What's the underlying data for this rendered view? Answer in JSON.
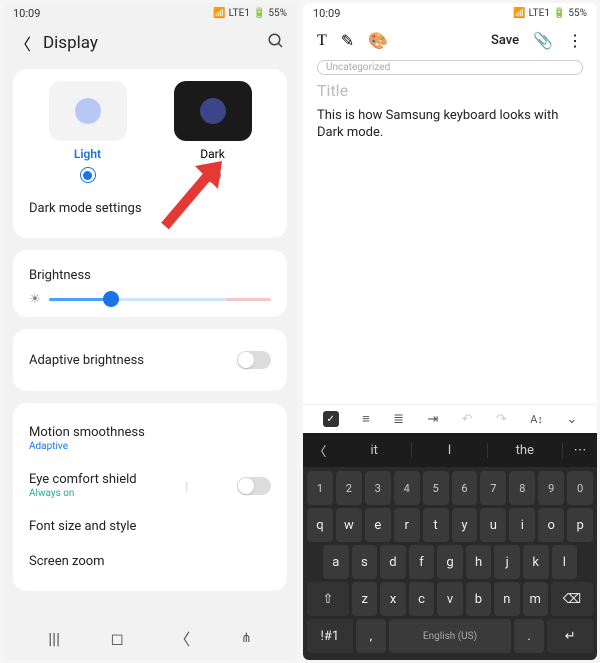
{
  "status": {
    "time": "10:09",
    "battery": "55%",
    "net": "LTE1"
  },
  "left": {
    "title": "Display",
    "theme": {
      "light": "Light",
      "dark": "Dark",
      "selected": "light"
    },
    "darkModeSettings": "Dark mode settings",
    "brightness": {
      "label": "Brightness",
      "value": 28
    },
    "adaptive": "Adaptive brightness",
    "motion": {
      "label": "Motion smoothness",
      "sub": "Adaptive"
    },
    "eye": {
      "label": "Eye comfort shield",
      "sub": "Always on"
    },
    "font": "Font size and style",
    "zoom": "Screen zoom"
  },
  "right": {
    "save": "Save",
    "tag": "Uncategorized",
    "titlePlaceholder": "Title",
    "body": "This is how Samsung keyboard looks with Dark mode.",
    "predictions": [
      "it",
      "I",
      "the"
    ],
    "spacebar": "English (US)",
    "symkey": "!#1",
    "rows": {
      "num": [
        "1",
        "2",
        "3",
        "4",
        "5",
        "6",
        "7",
        "8",
        "9",
        "0"
      ],
      "r1": [
        "q",
        "w",
        "e",
        "r",
        "t",
        "y",
        "u",
        "i",
        "o",
        "p"
      ],
      "r2": [
        "a",
        "s",
        "d",
        "f",
        "g",
        "h",
        "j",
        "k",
        "l"
      ],
      "r3": [
        "z",
        "x",
        "c",
        "v",
        "b",
        "n",
        "m"
      ]
    }
  }
}
